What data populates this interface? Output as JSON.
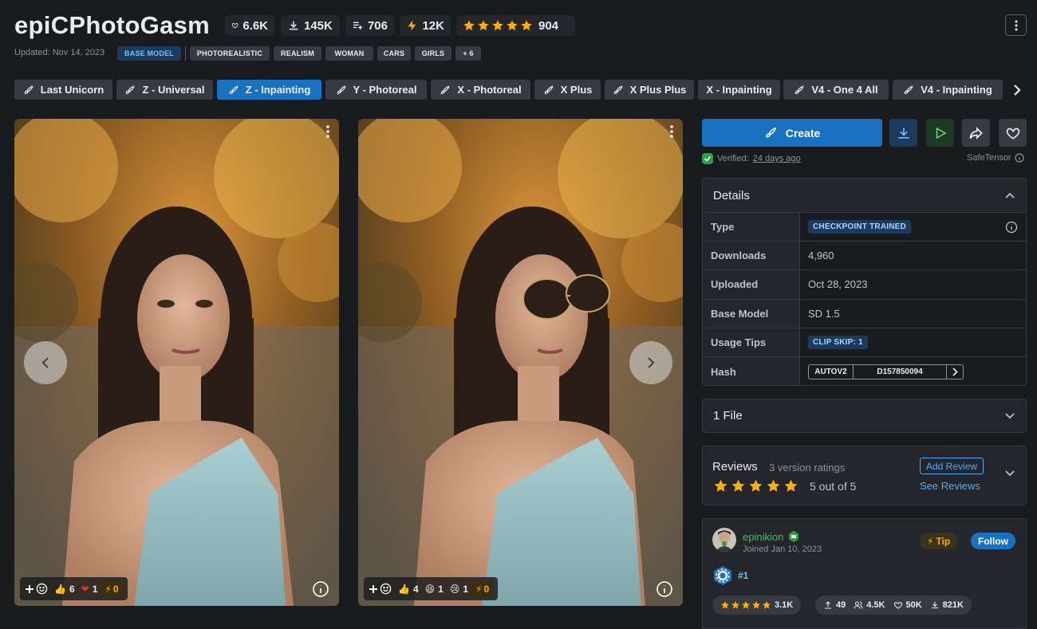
{
  "header": {
    "title": "epiCPhotoGasm",
    "stats": {
      "likes": "6.6K",
      "downloads": "145K",
      "collected": "706",
      "buzz": "12K",
      "rating_count": "904"
    },
    "updated": "Updated: Nov 14, 2023",
    "base_model_tag": "BASE MODEL",
    "tags": [
      "PHOTOREALISTIC",
      "REALISM",
      "WOMAN",
      "CARS",
      "GIRLS",
      "+ 6"
    ]
  },
  "versions": [
    "Last Unicorn",
    "Z - Universal",
    "Z - Inpainting",
    "Y - Photoreal",
    "X - Photoreal",
    "X Plus",
    "X Plus Plus",
    "X - Inpainting",
    "V4 - One 4 All",
    "V4 - Inpainting"
  ],
  "active_version_index": 2,
  "images": [
    {
      "reactions": {
        "thumbs": "6",
        "heart": "1",
        "buzz": "0"
      }
    },
    {
      "reactions": {
        "thumbs": "4",
        "laugh": "1",
        "cry": "1",
        "buzz": "0"
      }
    }
  ],
  "actions": {
    "create_label": "Create",
    "verified_label": "Verified:",
    "verified_date": "24 days ago",
    "safetensor_label": "SafeTensor"
  },
  "details": {
    "title": "Details",
    "rows": [
      {
        "key": "Type",
        "value": "CHECKPOINT TRAINED"
      },
      {
        "key": "Downloads",
        "value": "4,960"
      },
      {
        "key": "Uploaded",
        "value": "Oct 28, 2023"
      },
      {
        "key": "Base Model",
        "value": "SD 1.5"
      },
      {
        "key": "Usage Tips",
        "value": "CLIP SKIP: 1"
      },
      {
        "key": "Hash",
        "value": "D157850094",
        "hash_type": "AUTOV2"
      }
    ]
  },
  "files": {
    "label": "1 File"
  },
  "reviews": {
    "title": "Reviews",
    "count": "3 version ratings",
    "score": "5 out of 5",
    "add_label": "Add Review",
    "see_label": "See Reviews",
    "stars": 5
  },
  "creator": {
    "name": "epinikion",
    "joined": "Joined Jan 10, 2023",
    "tip_label": "Tip",
    "follow_label": "Follow",
    "rank": "#1",
    "stats": {
      "rating": "3.1K",
      "uploads": "49",
      "followers": "4.5K",
      "likes": "50K",
      "downloads": "821K"
    }
  },
  "colors": {
    "accent": "#1971c2",
    "star": "#fab005",
    "verified": "#40c057",
    "background": "#1a1b1e"
  }
}
